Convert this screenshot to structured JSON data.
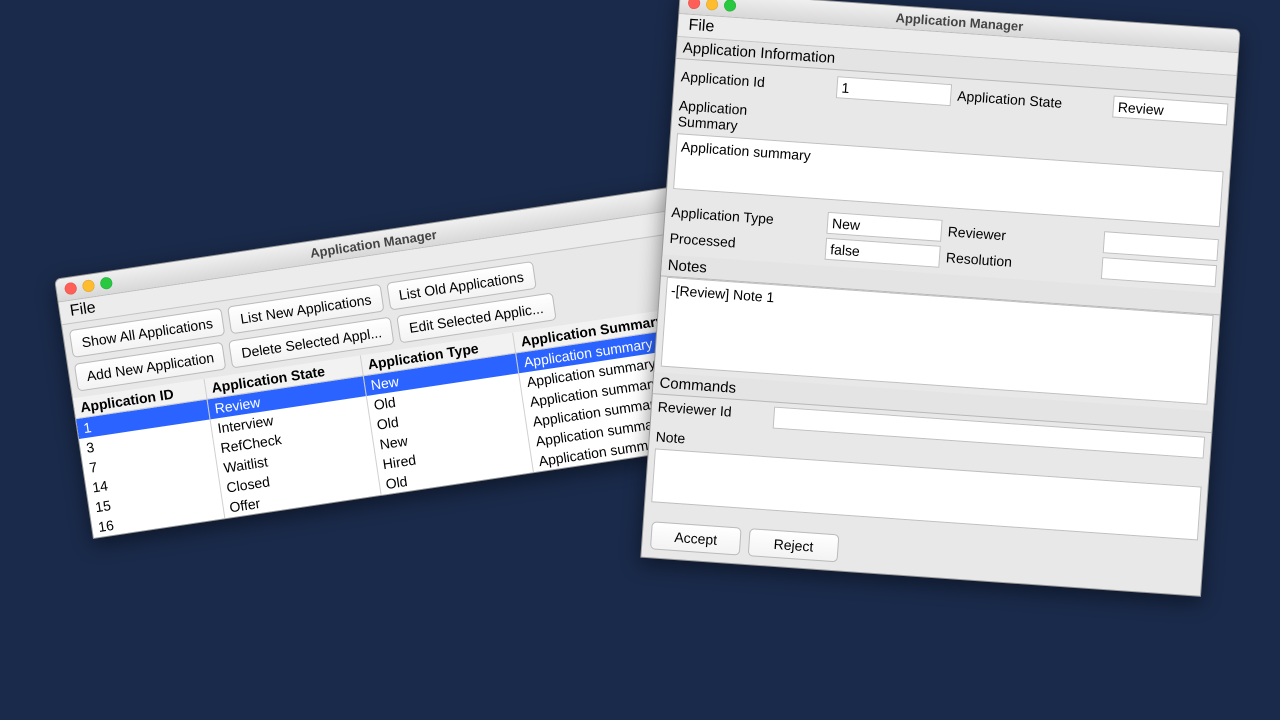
{
  "list_window": {
    "title": "Application Manager",
    "menu": {
      "file": "File"
    },
    "buttons": {
      "show_all": "Show All Applications",
      "list_new": "List New Applications",
      "list_old": "List Old Applications",
      "add_new": "Add New Application",
      "delete_sel": "Delete Selected Appl...",
      "edit_sel": "Edit Selected Applic..."
    },
    "table": {
      "headers": {
        "id": "Application ID",
        "state": "Application State",
        "type": "Application Type",
        "summary": "Application Summary"
      },
      "rows": [
        {
          "id": "1",
          "state": "Review",
          "type": "New",
          "summary": "Application summary",
          "selected": true
        },
        {
          "id": "3",
          "state": "Interview",
          "type": "Old",
          "summary": "Application summary",
          "selected": false
        },
        {
          "id": "7",
          "state": "RefCheck",
          "type": "Old",
          "summary": "Application summary",
          "selected": false
        },
        {
          "id": "14",
          "state": "Waitlist",
          "type": "New",
          "summary": "Application summary",
          "selected": false
        },
        {
          "id": "15",
          "state": "Closed",
          "type": "Hired",
          "summary": "Application summary",
          "selected": false
        },
        {
          "id": "16",
          "state": "Offer",
          "type": "Old",
          "summary": "Application summary",
          "selected": false
        }
      ]
    }
  },
  "detail_window": {
    "title": "Application Manager",
    "menu": {
      "file": "File"
    },
    "sections": {
      "info": "Application Information",
      "notes": "Notes",
      "commands": "Commands"
    },
    "labels": {
      "app_id": "Application Id",
      "app_state": "Application State",
      "app_summary": "Application Summary",
      "app_type": "Application Type",
      "reviewer": "Reviewer",
      "processed": "Processed",
      "resolution": "Resolution",
      "reviewer_id": "Reviewer Id",
      "note": "Note"
    },
    "values": {
      "app_id": "1",
      "app_state": "Review",
      "app_summary": "Application summary",
      "app_type": "New",
      "reviewer": "",
      "processed": "false",
      "resolution": "",
      "notes_text": "-[Review] Note 1",
      "reviewer_id": "",
      "note": ""
    },
    "buttons": {
      "accept": "Accept",
      "reject": "Reject"
    }
  }
}
